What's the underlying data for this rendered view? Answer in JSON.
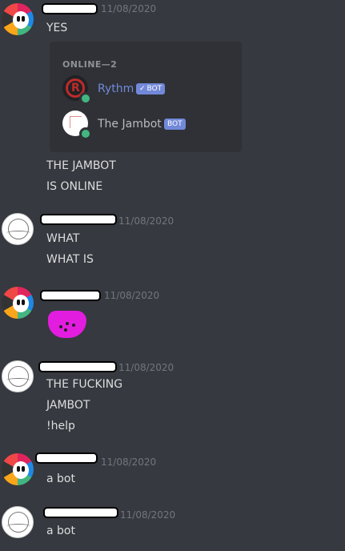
{
  "messages": [
    {
      "timestamp": "11/08/2020",
      "lines": [
        "YES"
      ]
    },
    {
      "timestamp": "",
      "lines": [
        "THE JAMBOT",
        "IS ONLINE"
      ]
    },
    {
      "timestamp": "11/08/2020",
      "lines": [
        "WHAT",
        "WHAT IS"
      ]
    },
    {
      "timestamp": "11/08/2020",
      "lines": []
    },
    {
      "timestamp": "11/08/2020",
      "lines": [
        "THE FUCKING",
        "JAMBOT",
        "!help"
      ]
    },
    {
      "timestamp": "11/08/2020",
      "lines": [
        "a bot"
      ]
    },
    {
      "timestamp": "11/08/2020",
      "lines": [
        "a bot"
      ]
    }
  ],
  "member_list": {
    "heading": "ONLINE—2",
    "members": [
      {
        "name": "Rythm",
        "tag": "BOT",
        "verified": true,
        "status_color": "#43b581"
      },
      {
        "name": "The Jambot",
        "tag": "BOT",
        "verified": false,
        "status_color": "#43b581"
      }
    ]
  },
  "colors": {
    "background": "#36393f",
    "card": "#2f3136",
    "bot_tag": "#7289da",
    "online": "#43b581",
    "sticker": "#e21ddf"
  },
  "icons": {
    "verified": "✓"
  }
}
